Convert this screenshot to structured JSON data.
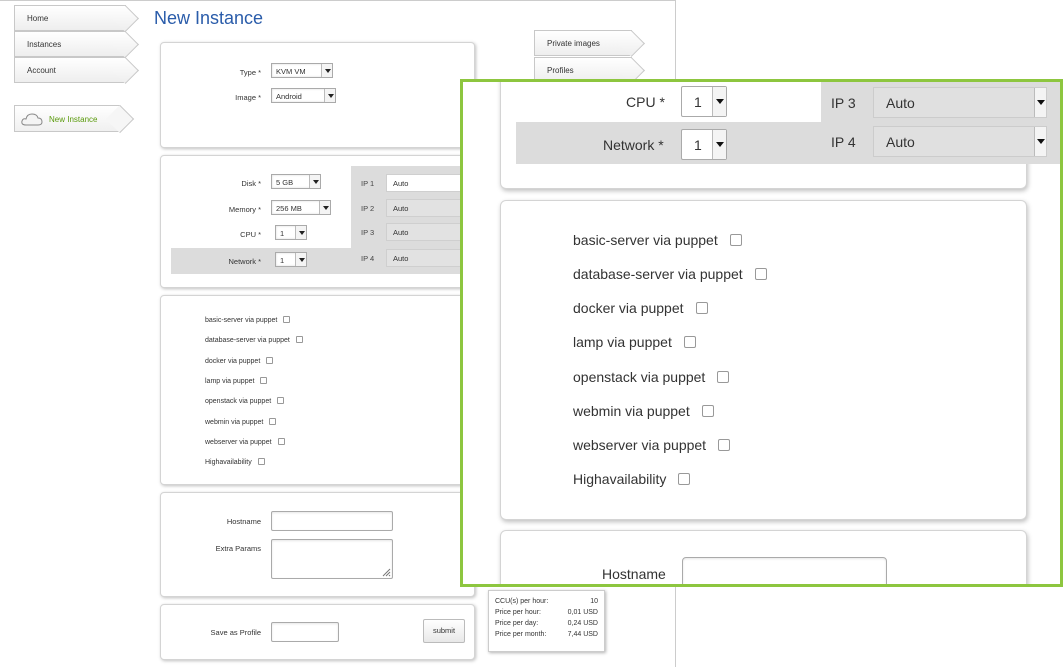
{
  "sidebar": {
    "tabs": [
      "Home",
      "Instances",
      "Account"
    ],
    "new_instance": "New Instance"
  },
  "page_title": "New Instance",
  "right_tabs": [
    "Private images",
    "Profiles"
  ],
  "form": {
    "type": {
      "label": "Type *",
      "value": "KVM VM"
    },
    "image": {
      "label": "Image *",
      "value": "Android"
    },
    "disk": {
      "label": "Disk *",
      "value": "5 GB"
    },
    "memory": {
      "label": "Memory *",
      "value": "256 MB"
    },
    "cpu": {
      "label": "CPU *",
      "value": "1"
    },
    "network": {
      "label": "Network *",
      "value": "1"
    },
    "ips": [
      {
        "label": "IP 1",
        "value": "Auto"
      },
      {
        "label": "IP 2",
        "value": "Auto"
      },
      {
        "label": "IP 3",
        "value": "Auto"
      },
      {
        "label": "IP 4",
        "value": "Auto"
      }
    ],
    "puppet_options": [
      "basic-server via puppet",
      "database-server via puppet",
      "docker via puppet",
      "lamp via puppet",
      "openstack via puppet",
      "webmin via puppet",
      "webserver via puppet",
      "Highavailability"
    ],
    "hostname_label": "Hostname",
    "extra_params_label": "Extra Params",
    "save_profile_label": "Save as Profile",
    "submit_label": "submit"
  },
  "pricing": {
    "rows": [
      {
        "label": "CCU(s) per hour:",
        "value": "10"
      },
      {
        "label": "Price per hour:",
        "value": "0,01 USD"
      },
      {
        "label": "Price per day:",
        "value": "0,24 USD"
      },
      {
        "label": "Price per month:",
        "value": "7,44 USD"
      }
    ]
  },
  "colors": {
    "title": "#2a5caa",
    "accent_green": "#8dc63f",
    "active_tab_text": "#5a9a0c"
  }
}
